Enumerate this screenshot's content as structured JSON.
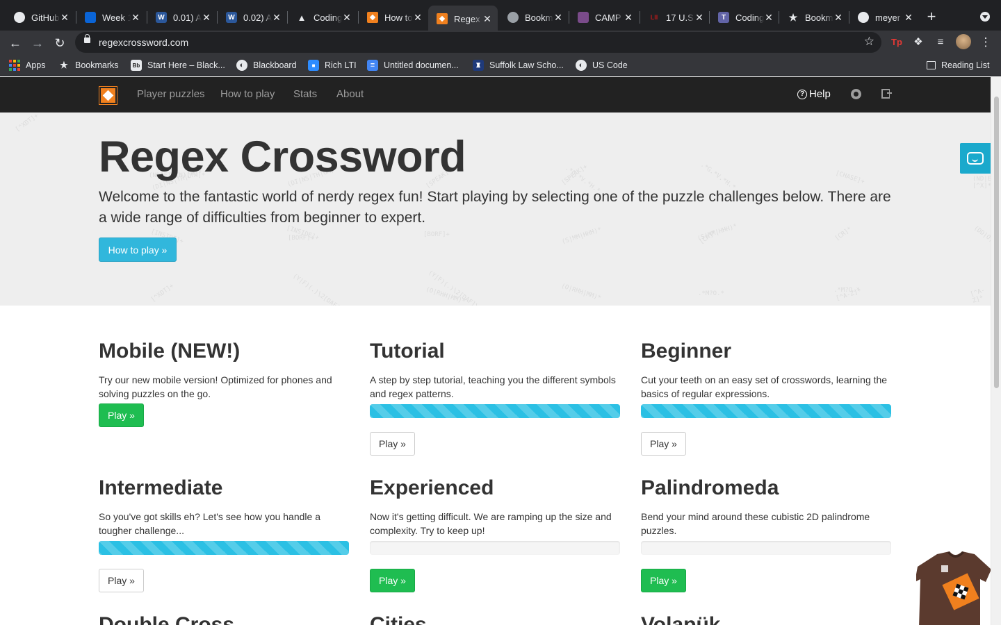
{
  "browser": {
    "tabs": [
      {
        "title": "GitHub",
        "favicon": "github-icon",
        "color": "#e8eaed"
      },
      {
        "title": "Week 1",
        "favicon": "onedrive-icon",
        "color": "#0a64d6"
      },
      {
        "title": "0.01) A",
        "favicon": "word-icon",
        "color": "#2b579a"
      },
      {
        "title": "0.02) A",
        "favicon": "word-icon",
        "color": "#2b579a"
      },
      {
        "title": "Coding",
        "favicon": "sailboat-icon",
        "color": "#e8eaed"
      },
      {
        "title": "How to",
        "favicon": "regex-crossword-icon",
        "color": "#f0801e"
      },
      {
        "title": "Regex",
        "favicon": "regex-crossword-icon",
        "color": "#f0801e",
        "active": true
      },
      {
        "title": "Bookm",
        "favicon": "globe-icon",
        "color": "#9aa0a6"
      },
      {
        "title": "CAMP",
        "favicon": "campus-icon",
        "color": "#7a4b8a"
      },
      {
        "title": "17 U.S",
        "favicon": "lii-icon",
        "color": "#b31b1b"
      },
      {
        "title": "Coding",
        "favicon": "teams-icon",
        "color": "#6264a7"
      },
      {
        "title": "Bookm",
        "favicon": "star-icon",
        "color": "#e8eaed"
      },
      {
        "title": "meyer",
        "favicon": "github-icon",
        "color": "#e8eaed"
      }
    ],
    "url": "regexcrossword.com",
    "bookmarks": [
      {
        "label": "Apps",
        "icon": "apps-grid-icon"
      },
      {
        "label": "Bookmarks",
        "icon": "star-icon"
      },
      {
        "label": "Start Here – Black...",
        "icon": "blackboard-bb-icon"
      },
      {
        "label": "Blackboard",
        "icon": "globe-icon"
      },
      {
        "label": "Rich LTI",
        "icon": "zoom-icon"
      },
      {
        "label": "Untitled documen...",
        "icon": "google-docs-icon"
      },
      {
        "label": "Suffolk Law Scho...",
        "icon": "suffolk-icon"
      },
      {
        "label": "US Code",
        "icon": "globe-icon"
      }
    ],
    "reading_list": "Reading List",
    "colors": {
      "tabstrip": "#202124",
      "toolbar": "#35363a"
    }
  },
  "site": {
    "nav": [
      "Player puzzles",
      "How to play",
      "Stats",
      "About"
    ],
    "help": "Help",
    "hero": {
      "title": "Regex Crossword",
      "lead": "Welcome to the fantastic world of nerdy regex fun! Start playing by selecting one of the puzzle challenges below. There are a wide range of difficulties from beginner to expert.",
      "button": "How to play »"
    },
    "cards": [
      {
        "title": "Mobile (NEW!)",
        "desc": "Try our new mobile version! Optimized for phones and solving puzzles on the go.",
        "progress": null,
        "button": "Play »",
        "style": "success"
      },
      {
        "title": "Tutorial",
        "desc": "A step by step tutorial, teaching you the different symbols and regex patterns.",
        "progress": 1.0,
        "button": "Play »",
        "style": "default"
      },
      {
        "title": "Beginner",
        "desc": "Cut your teeth on an easy set of crosswords, learning the basics of regular expressions.",
        "progress": 1.0,
        "button": "Play »",
        "style": "default"
      },
      {
        "title": "Intermediate",
        "desc": "So you've got skills eh? Let's see how you handle a tougher challenge...",
        "progress": 1.0,
        "button": "Play »",
        "style": "default"
      },
      {
        "title": "Experienced",
        "desc": "Now it's getting difficult. We are ramping up the size and complexity. Try to keep up!",
        "progress": 0.0,
        "button": "Play »",
        "style": "success"
      },
      {
        "title": "Palindromeda",
        "desc": "Bend your mind around these cubistic 2D palindrome puzzles.",
        "progress": 0.0,
        "button": "Play »",
        "style": "success"
      },
      {
        "title": "Double Cross",
        "desc": "",
        "progress": null,
        "button": "",
        "style": "none"
      },
      {
        "title": "Cities",
        "desc": "",
        "progress": null,
        "button": "",
        "style": "none"
      },
      {
        "title": "Volapük",
        "desc": "",
        "progress": null,
        "button": "",
        "style": "none"
      }
    ],
    "colors": {
      "brand": "#f0801e",
      "info": "#31b7dc",
      "success": "#1fbd51",
      "progress": "#2bc0e4"
    }
  }
}
